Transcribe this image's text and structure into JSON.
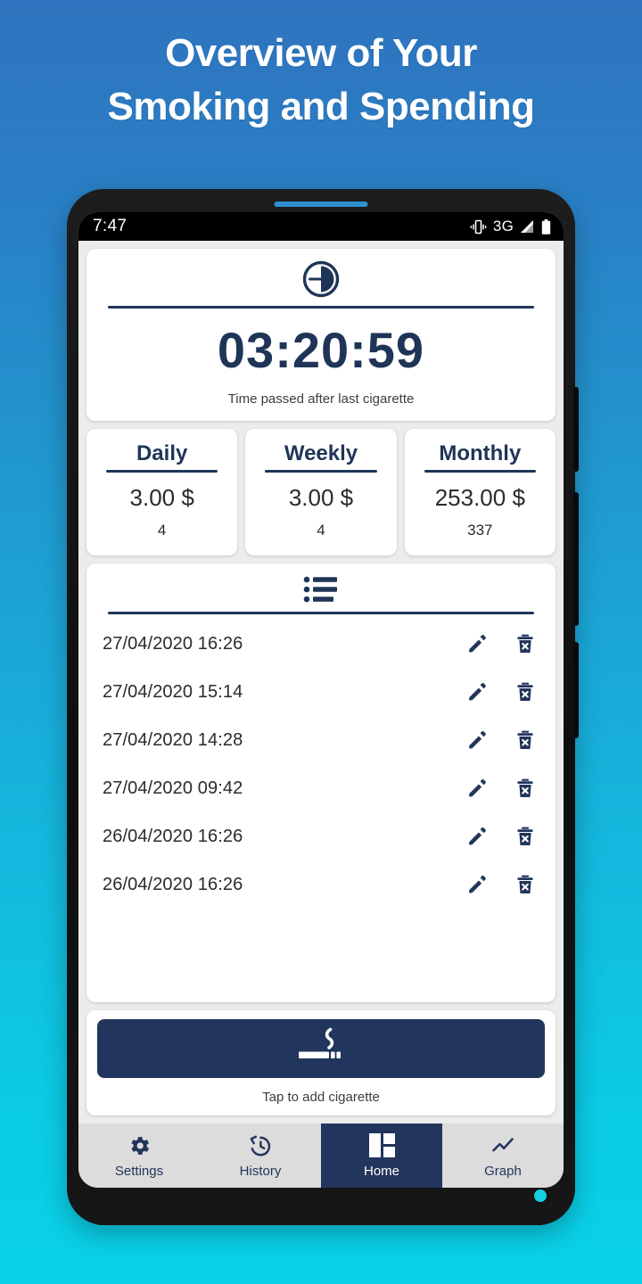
{
  "headline": {
    "line1": "Overview of Your",
    "line2": "Smoking and Spending"
  },
  "colors": {
    "brand_navy": "#22355c",
    "bg_top": "#2f74be",
    "bg_bottom": "#09d2e8",
    "card_white": "#ffffff",
    "screen_gray": "#ececec",
    "nav_gray": "#dcdcdc"
  },
  "statusbar": {
    "time": "7:47",
    "network": "3G",
    "vibrate_icon": "vibrate-icon",
    "signal_icon": "signal-bars-icon",
    "battery_icon": "battery-full-icon"
  },
  "timer_card": {
    "icon": "clock-elapsed-icon",
    "value": "03:20:59",
    "caption": "Time passed after last cigarette"
  },
  "stats": [
    {
      "title": "Daily",
      "amount": "3.00 $",
      "count": "4"
    },
    {
      "title": "Weekly",
      "amount": "3.00 $",
      "count": "4"
    },
    {
      "title": "Monthly",
      "amount": "253.00 $",
      "count": "337"
    }
  ],
  "list_card": {
    "icon": "bulleted-list-icon",
    "edit_icon": "pencil-icon",
    "delete_icon": "trash-x-icon",
    "entries": [
      {
        "datetime": "27/04/2020 16:26"
      },
      {
        "datetime": "27/04/2020 15:14"
      },
      {
        "datetime": "27/04/2020 14:28"
      },
      {
        "datetime": "27/04/2020 09:42"
      },
      {
        "datetime": "26/04/2020 16:26"
      },
      {
        "datetime": "26/04/2020 16:26"
      }
    ]
  },
  "add_card": {
    "icon": "cigarette-icon",
    "caption": "Tap to add cigarette"
  },
  "bottomnav": {
    "items": [
      {
        "label": "Settings",
        "icon": "gear-icon",
        "active": false
      },
      {
        "label": "History",
        "icon": "history-icon",
        "active": false
      },
      {
        "label": "Home",
        "icon": "dashboard-icon",
        "active": true
      },
      {
        "label": "Graph",
        "icon": "trend-line-icon",
        "active": false
      }
    ]
  }
}
